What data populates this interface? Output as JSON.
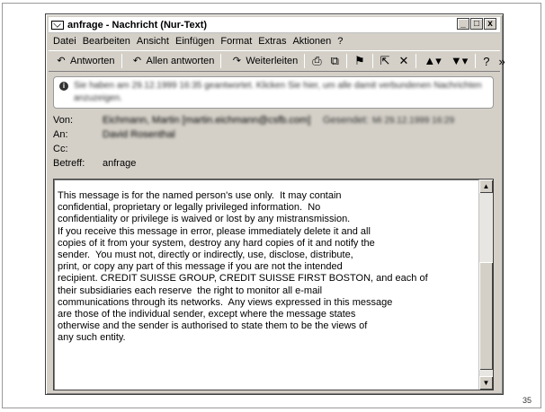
{
  "slide": {
    "number": "35"
  },
  "window": {
    "title": "anfrage - Nachricht (Nur-Text)",
    "caption_buttons": {
      "minimize": "_",
      "maximize": "□",
      "close": "x"
    }
  },
  "menu": [
    "Datei",
    "Bearbeiten",
    "Ansicht",
    "Einfügen",
    "Format",
    "Extras",
    "Aktionen",
    "?"
  ],
  "toolbar": {
    "reply": "Antworten",
    "reply_all": "Allen antworten",
    "forward": "Weiterleiten",
    "more": "»"
  },
  "infobar": {
    "line1": "Sie haben am 29.12.1999 16:35 geantwortet. Klicken Sie hier, um alle damit verbundenen Nachrichten",
    "line2": "anzuzeigen."
  },
  "header": {
    "from_label": "Von:",
    "from_value": "Eichmann, Martin [martin.eichmann@csfb.com]",
    "sent_label": "Gesendet:",
    "sent_value": "Mi 29.12.1999 16:29",
    "to_label": "An:",
    "to_value": "David Rosenthal",
    "cc_label": "Cc:",
    "cc_value": "",
    "subject_label": "Betreff:",
    "subject_value": "anfrage"
  },
  "body_text": "This message is for the named person's use only.  It may contain\nconfidential, proprietary or legally privileged information.  No\nconfidentiality or privilege is waived or lost by any mistransmission.\nIf you receive this message in error, please immediately delete it and all\ncopies of it from your system, destroy any hard copies of it and notify the\nsender.  You must not, directly or indirectly, use, disclose, distribute,\nprint, or copy any part of this message if you are not the intended\nrecipient. CREDIT SUISSE GROUP, CREDIT SUISSE FIRST BOSTON, and each of\ntheir subsidiaries each reserve  the right to monitor all e-mail\ncommunications through its networks.  Any views expressed in this message\nare those of the individual sender, except where the message states\notherwise and the sender is authorised to state them to be the views of\nany such entity."
}
